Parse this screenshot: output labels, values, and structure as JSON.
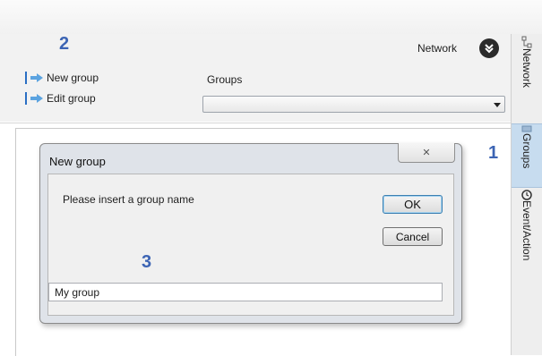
{
  "markers": {
    "top": "2",
    "right": "1",
    "dialog": "3"
  },
  "toolbar": {
    "actions": [
      {
        "label": "New group",
        "icon": "arrow-right-icon"
      },
      {
        "label": "Edit group",
        "icon": "arrow-right-icon"
      }
    ],
    "groups_label": "Groups",
    "groups_select_value": "",
    "network_label": "Network"
  },
  "side_tabs": [
    {
      "label": "Network",
      "icon": "network-icon"
    },
    {
      "label": "Groups",
      "icon": "groups-icon",
      "selected": true
    },
    {
      "label": "Event/Action",
      "icon": "clock-icon"
    }
  ],
  "dialog": {
    "title": "New group",
    "prompt": "Please insert a group name",
    "ok_label": "OK",
    "cancel_label": "Cancel",
    "close_glyph": "✕",
    "input_value": "My group"
  },
  "colors": {
    "accent": "#3c64b4",
    "selected_tab": "#c7dcef",
    "dialog_frame": "#dfe3e9"
  }
}
